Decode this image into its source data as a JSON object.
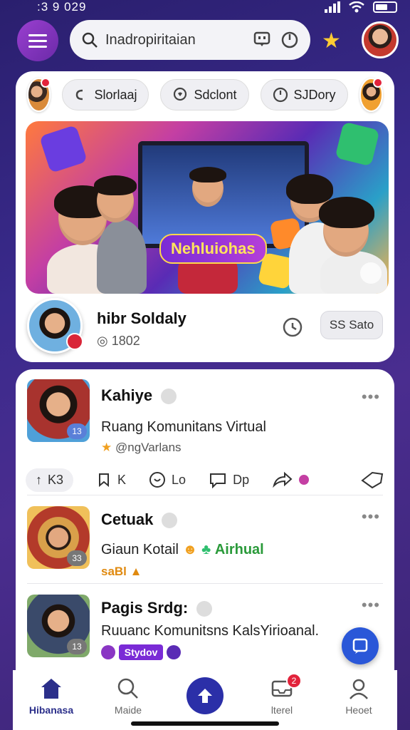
{
  "status": {
    "time": ":3 9 029"
  },
  "search": {
    "text": "Inadropiritaian"
  },
  "chips": [
    {
      "label": "Slorlaaj"
    },
    {
      "label": "Sdclont"
    },
    {
      "label": "SJDory"
    }
  ],
  "hero": {
    "label": "Nehluiohas"
  },
  "profile": {
    "name": "hibr Soldaly",
    "count": "1802",
    "status_button": "SS Sato"
  },
  "posts": [
    {
      "title": "Kahiye",
      "line": "Ruang Komunitans Virtual",
      "sub": "@ngVarlans",
      "badge": "13"
    },
    {
      "title": "Cetuak",
      "line_a": "Giaun Kotail",
      "line_b": "Airhual",
      "sub": "saBl",
      "badge": "33"
    },
    {
      "title": "Pagis Srdg:",
      "line": "Ruuanc Komunitsns KalsYirioanal.",
      "tag": "Stydov",
      "badge": "13"
    }
  ],
  "actions": [
    {
      "label": "K3"
    },
    {
      "label": "K"
    },
    {
      "label": "Lo"
    },
    {
      "label": "Dp"
    }
  ],
  "nav": [
    {
      "label": "Hibanasa"
    },
    {
      "label": "Maide"
    },
    {
      "label": ""
    },
    {
      "label": "lterel",
      "badge": "2"
    },
    {
      "label": "Heoet"
    }
  ],
  "colors": {
    "accent": "#2b2fa8",
    "menu": "#8a36c4",
    "badge": "#e2233b",
    "fab": "#2a57d8"
  }
}
